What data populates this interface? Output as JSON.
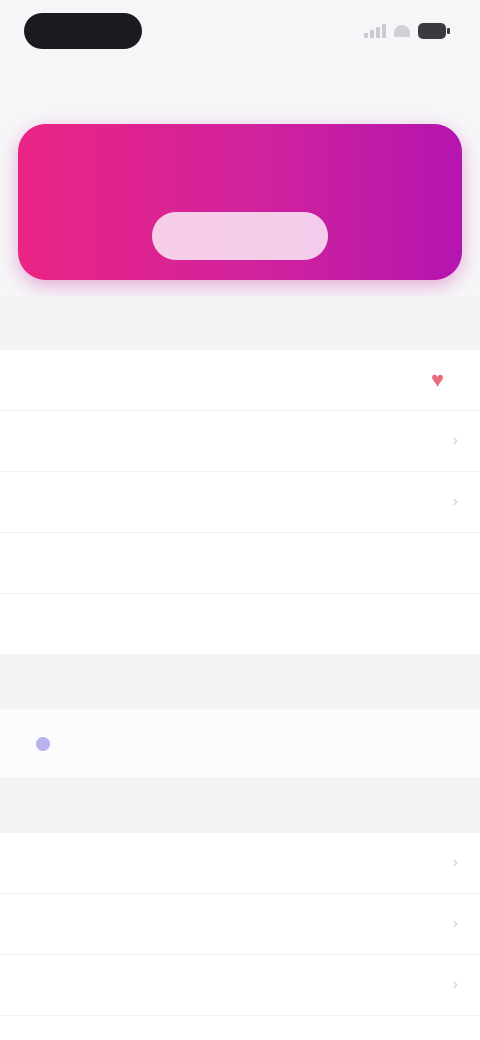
{
  "status_bar": {
    "time": "",
    "icons": [
      "signal-icon",
      "wifi-icon",
      "battery-icon"
    ]
  },
  "header": {
    "title": ""
  },
  "banner": {
    "button_label": "",
    "gradient": [
      "#ea2483",
      "#d0229e",
      "#b415ae"
    ]
  },
  "sections": [
    {
      "header": "",
      "rows": [
        {
          "label": "",
          "value": "",
          "icon": "heart-icon"
        },
        {
          "label": "",
          "value": ""
        },
        {
          "label": "",
          "value": ""
        },
        {
          "label": "",
          "value": ""
        },
        {
          "label": "",
          "placeholder": ""
        }
      ]
    },
    {
      "header": "",
      "rows": [
        {
          "label": "",
          "note": "",
          "icon": "dot-icon"
        }
      ]
    },
    {
      "header": "",
      "rows": [
        {
          "label": "",
          "value": ""
        },
        {
          "label": "",
          "value": ""
        },
        {
          "label": "",
          "value": ""
        },
        {
          "label": "",
          "value": ""
        }
      ]
    }
  ],
  "colors": {
    "accent": "#d0229e",
    "background": "#f6f6f8",
    "heart": "#e96a7c"
  }
}
